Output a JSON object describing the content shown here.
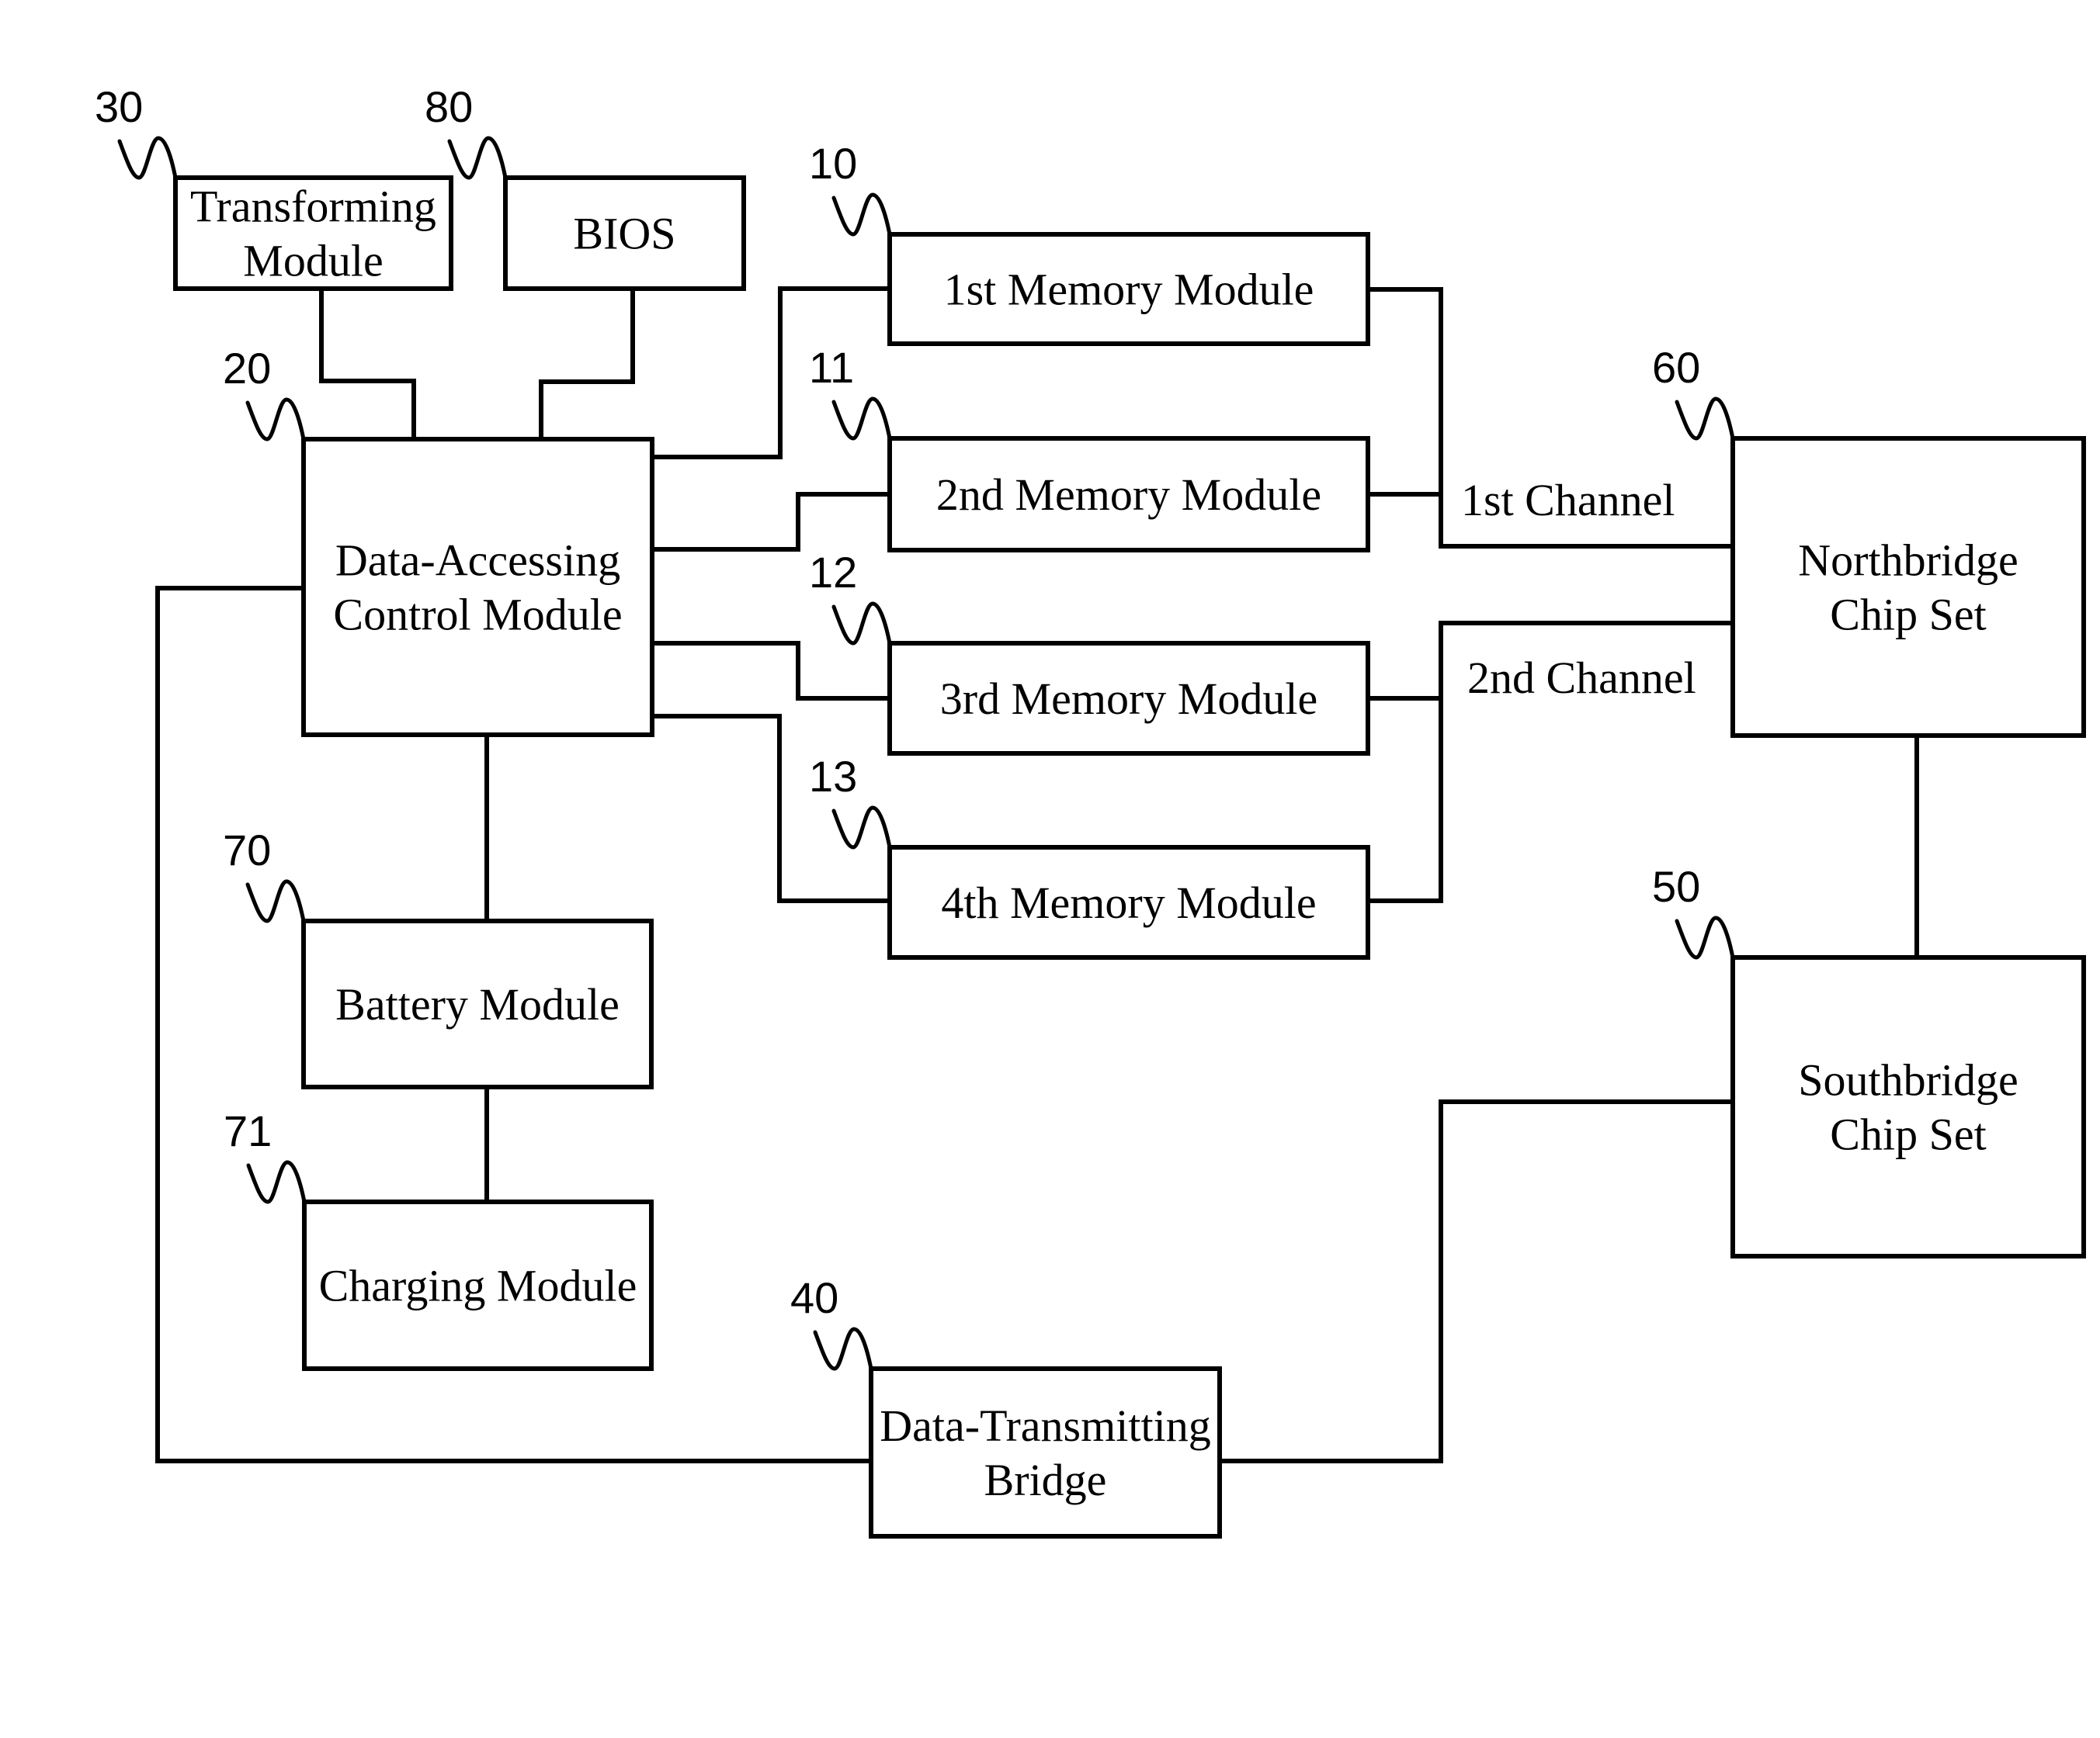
{
  "diagram": {
    "type": "block-diagram",
    "stroke_color": "#000000",
    "background_color": "#ffffff",
    "blocks": [
      {
        "id": "transforming",
        "ref": "30",
        "lines": [
          "Transforming",
          "Module"
        ]
      },
      {
        "id": "bios",
        "ref": "80",
        "lines": [
          "BIOS"
        ]
      },
      {
        "id": "dac",
        "ref": "20",
        "lines": [
          "Data-Accessing",
          "Control Module"
        ]
      },
      {
        "id": "mem1",
        "ref": "10",
        "lines": [
          "1st Memory Module"
        ]
      },
      {
        "id": "mem2",
        "ref": "11",
        "lines": [
          "2nd Memory Module"
        ]
      },
      {
        "id": "mem3",
        "ref": "12",
        "lines": [
          "3rd Memory Module"
        ]
      },
      {
        "id": "mem4",
        "ref": "13",
        "lines": [
          "4th Memory Module"
        ]
      },
      {
        "id": "northbridge",
        "ref": "60",
        "lines": [
          "Northbridge",
          "Chip Set"
        ]
      },
      {
        "id": "southbridge",
        "ref": "50",
        "lines": [
          "Southbridge",
          "Chip Set"
        ]
      },
      {
        "id": "battery",
        "ref": "70",
        "lines": [
          "Battery Module"
        ]
      },
      {
        "id": "charging",
        "ref": "71",
        "lines": [
          "Charging Module"
        ]
      },
      {
        "id": "dtb",
        "ref": "40",
        "lines": [
          "Data-Transmitting",
          "Bridge"
        ]
      }
    ],
    "channels": [
      {
        "id": "ch1",
        "label": "1st Channel"
      },
      {
        "id": "ch2",
        "label": "2nd Channel"
      }
    ],
    "connections": [
      [
        "transforming",
        "dac"
      ],
      [
        "bios",
        "dac"
      ],
      [
        "dac",
        "mem1"
      ],
      [
        "dac",
        "mem2"
      ],
      [
        "dac",
        "mem3"
      ],
      [
        "dac",
        "mem4"
      ],
      [
        "mem1",
        "ch1"
      ],
      [
        "mem2",
        "ch1"
      ],
      [
        "ch1",
        "northbridge"
      ],
      [
        "mem3",
        "ch2"
      ],
      [
        "mem4",
        "ch2"
      ],
      [
        "ch2",
        "northbridge"
      ],
      [
        "northbridge",
        "southbridge"
      ],
      [
        "southbridge",
        "dtb"
      ],
      [
        "dtb",
        "dac"
      ],
      [
        "dac",
        "battery"
      ],
      [
        "battery",
        "charging"
      ]
    ]
  }
}
